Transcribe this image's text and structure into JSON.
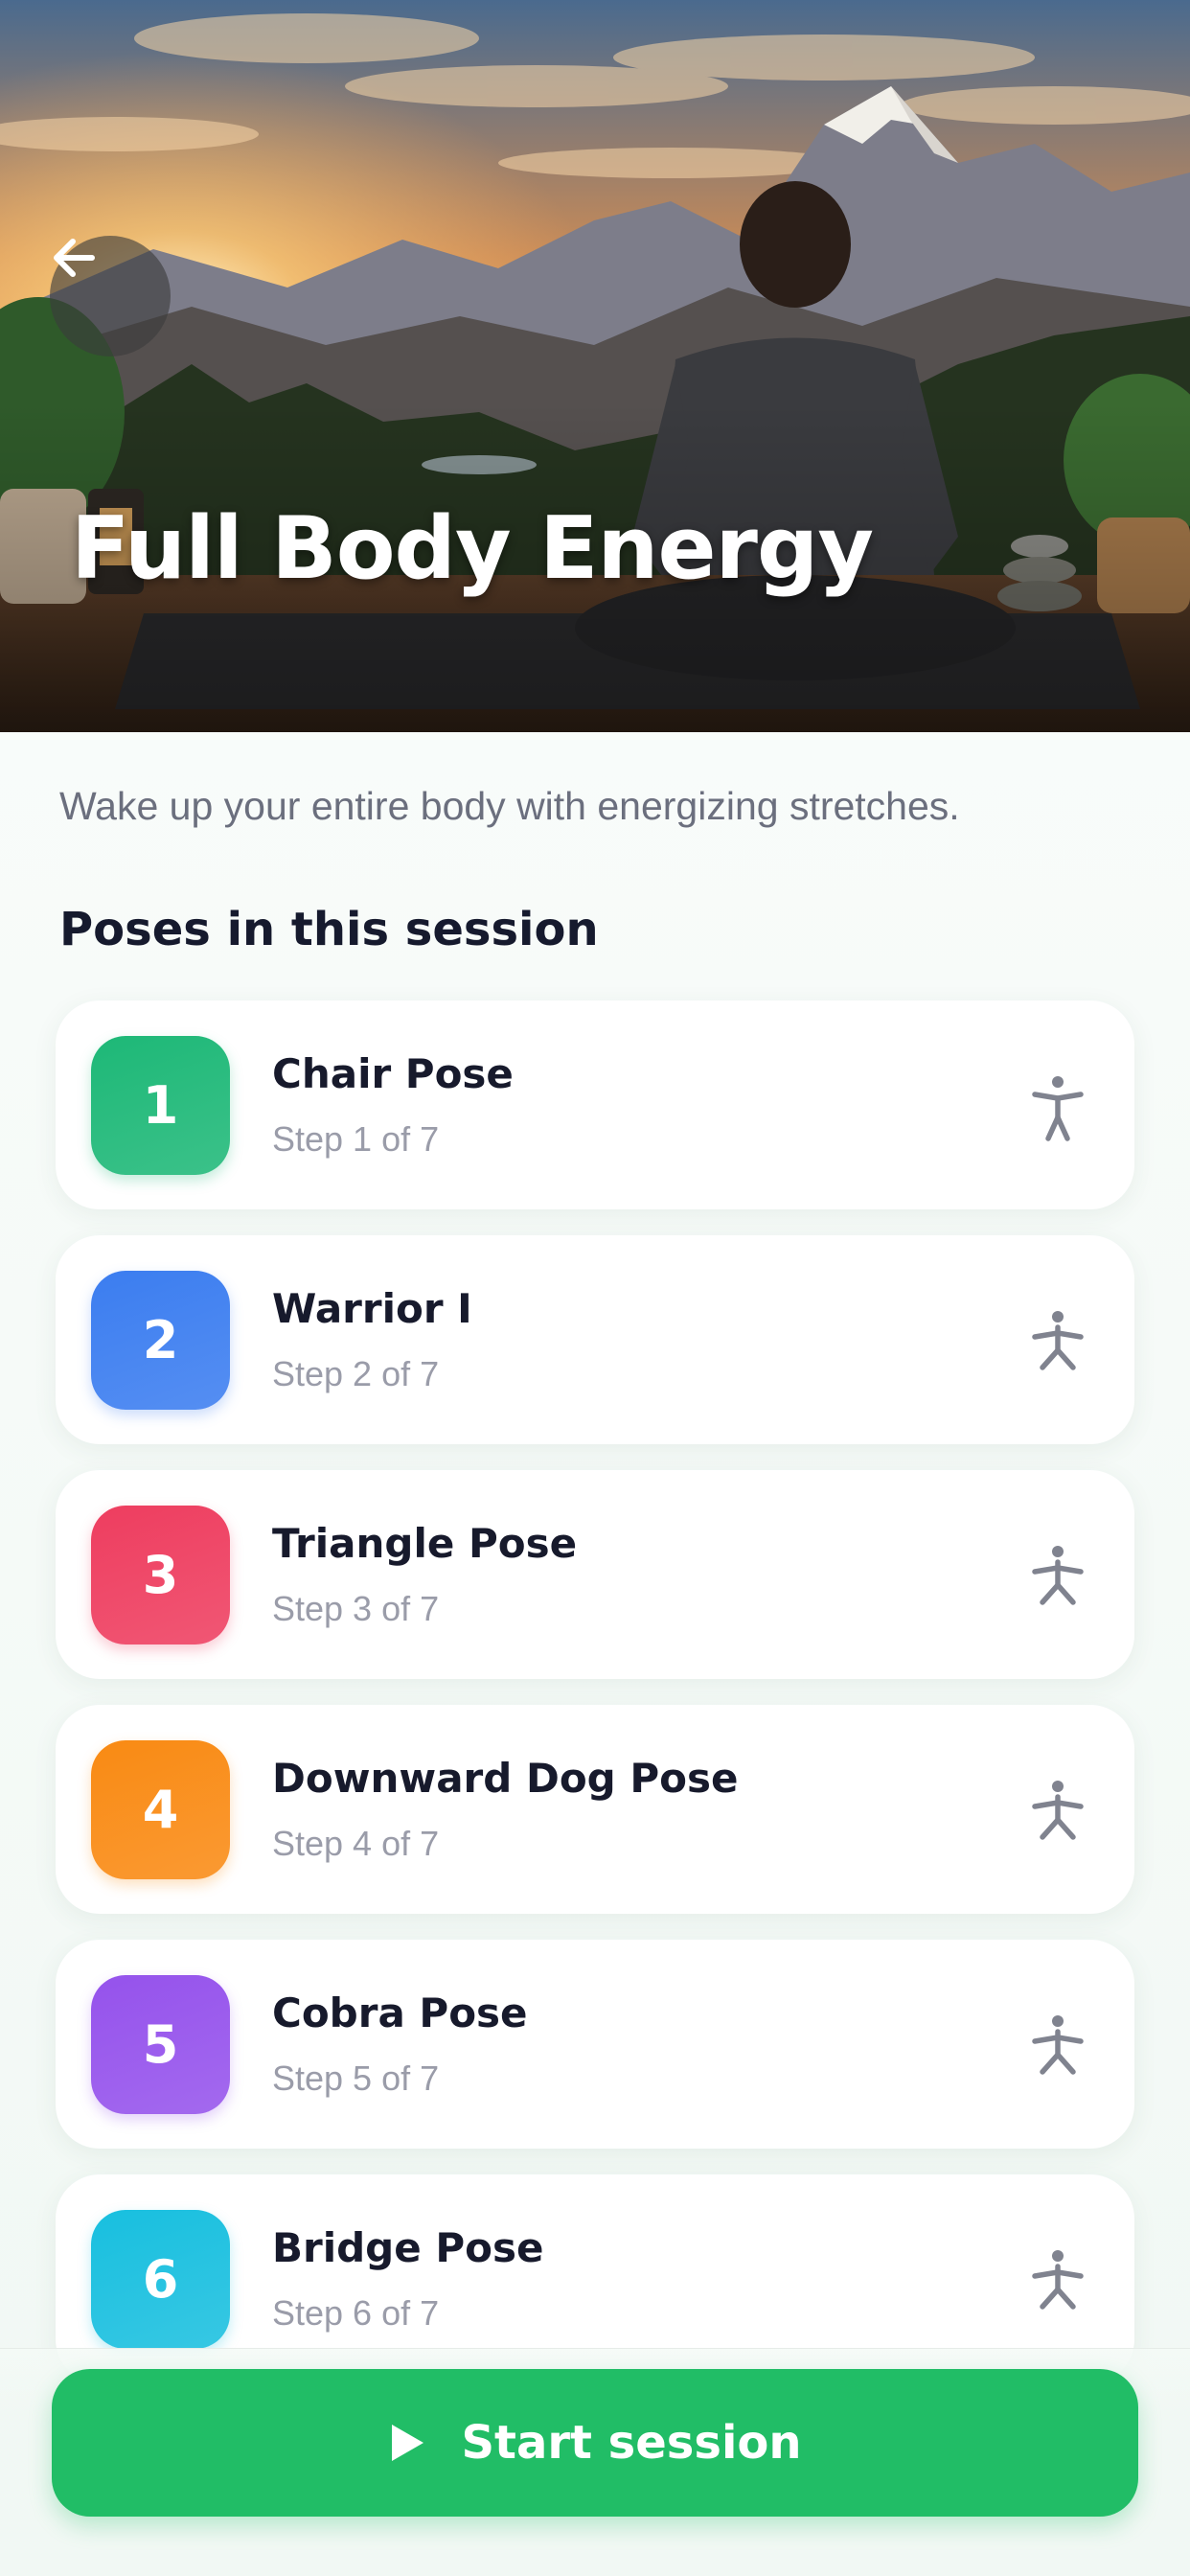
{
  "hero": {
    "title": "Full Body Energy",
    "back_icon": "arrow-left-icon"
  },
  "description": "Wake up your entire body with energizing stretches.",
  "section_title": "Poses in this session",
  "poses": [
    {
      "number": "1",
      "name": "Chair Pose",
      "step": "Step 1 of 7",
      "color": "#1db877",
      "icon": "person-standing-icon"
    },
    {
      "number": "2",
      "name": "Warrior I",
      "step": "Step 2 of 7",
      "color": "#3b7df0",
      "icon": "person-pose-icon"
    },
    {
      "number": "3",
      "name": "Triangle Pose",
      "step": "Step 3 of 7",
      "color": "#ee3d5f",
      "icon": "person-pose-icon"
    },
    {
      "number": "4",
      "name": "Downward Dog Pose",
      "step": "Step 4 of 7",
      "color": "#f98a13",
      "icon": "person-pose-icon"
    },
    {
      "number": "5",
      "name": "Cobra Pose",
      "step": "Step 5 of 7",
      "color": "#9552ec",
      "icon": "person-pose-icon"
    },
    {
      "number": "6",
      "name": "Bridge Pose",
      "step": "Step 6 of 7",
      "color": "#18bfdf",
      "icon": "person-pose-icon"
    }
  ],
  "start_button": {
    "label": "Start session",
    "icon": "play-icon",
    "color": "#21bd66"
  }
}
